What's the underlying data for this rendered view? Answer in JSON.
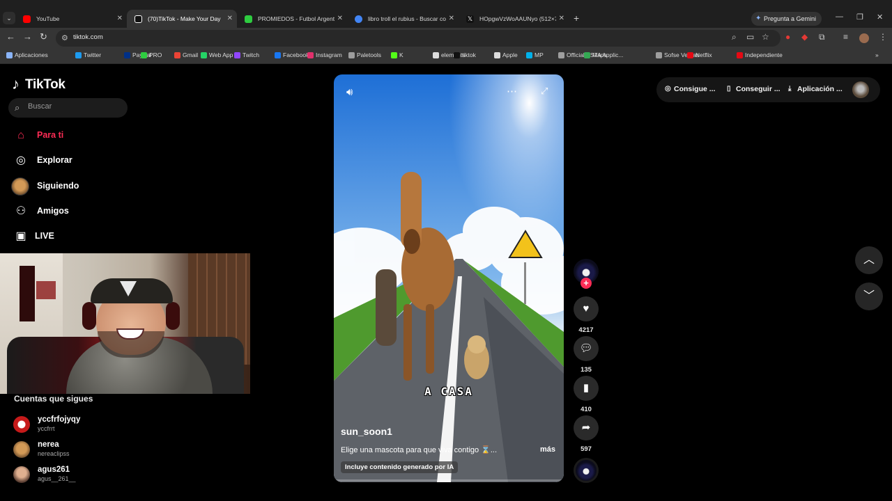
{
  "browser": {
    "tabs": [
      {
        "label": "YouTube",
        "color": "#ff0000",
        "active": false
      },
      {
        "label": "(70)TikTok - Make Your Day",
        "color": "#111111",
        "active": true
      },
      {
        "label": "PROMIEDOS - Futbol Argentino",
        "color": "#2ecc40",
        "active": false
      },
      {
        "label": "libro troll el rubius - Buscar con",
        "color": "#4285f4",
        "active": false
      },
      {
        "label": "HOpgwVzWoAAUNyo (512×72",
        "color": "#111111",
        "active": false
      }
    ],
    "gemini_label": "Pregunta a Gemini",
    "url": "tiktok.com",
    "bookmarks": [
      {
        "label": "Aplicaciones",
        "color": "#8ab4f8"
      },
      {
        "label": "Twitter",
        "color": "#1d9bf0"
      },
      {
        "label": "PayPal",
        "color": "#003087"
      },
      {
        "label": "PRO",
        "color": "#2ecc40"
      },
      {
        "label": "Gmail",
        "color": "#ea4335"
      },
      {
        "label": "Web App",
        "color": "#25d366"
      },
      {
        "label": "Twitch",
        "color": "#9146ff"
      },
      {
        "label": "Facebook",
        "color": "#1877f2"
      },
      {
        "label": "Instagram",
        "color": "#e1306c"
      },
      {
        "label": "Paletools",
        "color": "#9e9e9e"
      },
      {
        "label": "K",
        "color": "#53fc18"
      },
      {
        "label": "elements",
        "color": "#dddddd"
      },
      {
        "label": "tiktok",
        "color": "#111111"
      },
      {
        "label": "Apple",
        "color": "#dddddd"
      },
      {
        "label": "MP",
        "color": "#00b1ea"
      },
      {
        "label": "Official ESTA Applic...",
        "color": "#9e9e9e"
      },
      {
        "label": "Maps",
        "color": "#34a853"
      },
      {
        "label": "Sofse Ventas",
        "color": "#9e9e9e"
      },
      {
        "label": "Netflix",
        "color": "#e50914"
      },
      {
        "label": "Independiente",
        "color": "#e50914"
      }
    ]
  },
  "tiktok": {
    "logo_text": "TikTok",
    "search_placeholder": "Buscar",
    "nav": [
      {
        "label": "Para ti",
        "icon": "home-icon",
        "active": true
      },
      {
        "label": "Explorar",
        "icon": "compass-icon",
        "active": false
      },
      {
        "label": "Siguiendo",
        "icon": "avatar",
        "active": false
      },
      {
        "label": "Amigos",
        "icon": "friends-icon",
        "active": false
      },
      {
        "label": "LIVE",
        "icon": "live-icon",
        "active": false
      }
    ],
    "follows_title": "Cuentas que sigues",
    "follows": [
      {
        "name": "yccfrfojyqy",
        "handle": "yccfrrt",
        "color": "#c61a1a"
      },
      {
        "name": "nerea",
        "handle": "nereaclipss",
        "color": "#c9913f"
      },
      {
        "name": "agus261",
        "handle": "agus__261__",
        "color": "#c98c6b"
      }
    ],
    "accent": "#fe2c55"
  },
  "video": {
    "overlay_text": "A CASA",
    "author": "sun_soon1",
    "description": "Elige una mascota para que viva contigo ⌛...",
    "more_label": "más",
    "ai_label": "Incluye contenido generado por IA",
    "progress": 0.01
  },
  "actions": {
    "likes": "4217",
    "comments": "135",
    "saves": "410",
    "shares": "597"
  },
  "topbar": {
    "coins_label": "Consigue ...",
    "app_label": "Conseguir ...",
    "download_label": "Aplicación ..."
  }
}
